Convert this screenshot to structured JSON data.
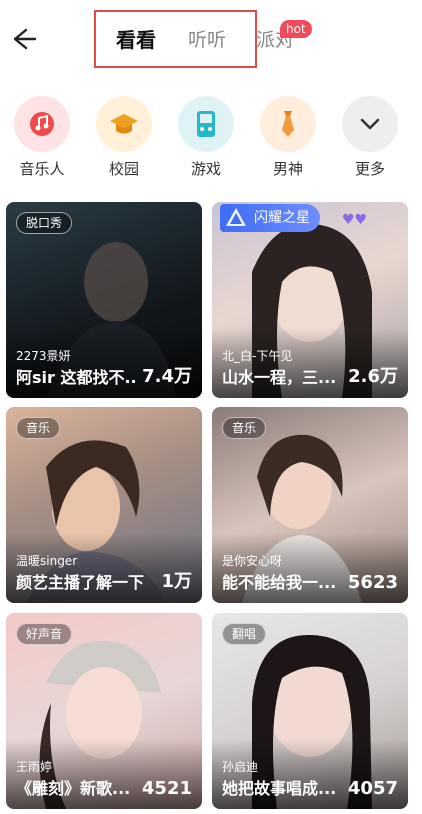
{
  "header": {
    "tabs": [
      {
        "label": "看看"
      },
      {
        "label": "听听"
      },
      {
        "label": "派对"
      }
    ],
    "hot_badge": "hot"
  },
  "categories": [
    {
      "label": "音乐人",
      "icon": "music-note-icon"
    },
    {
      "label": "校园",
      "icon": "graduation-cap-icon"
    },
    {
      "label": "游戏",
      "icon": "gamepad-icon"
    },
    {
      "label": "男神",
      "icon": "necktie-icon"
    },
    {
      "label": "更多",
      "icon": "chevron-down-icon"
    }
  ],
  "cards": [
    {
      "tag": "脱口秀",
      "host": "2273景妍",
      "title": "阿sir 这都找不...",
      "count": "7.4万"
    },
    {
      "badge": "闪耀之星",
      "host": "北_白-下午见",
      "title": "山水一程，三...",
      "count": "2.6万"
    },
    {
      "tag": "音乐",
      "host": "温暖singer",
      "title": "颜艺主播了解一下",
      "count": "1万"
    },
    {
      "tag": "音乐",
      "host": "是你安心呀",
      "title": "能不能给我一...",
      "count": "5623"
    },
    {
      "tag": "好声音",
      "host": "王雨婷",
      "title": "《雕刻》新歌...",
      "count": "4521"
    },
    {
      "tag": "翻唱",
      "host": "孙启迪",
      "title": "她把故事唱成...",
      "count": "4057"
    }
  ],
  "colors": {
    "highlight_border": "#e54848",
    "hot_badge": "#f24a5a",
    "star_badge": "#3f6df2"
  }
}
